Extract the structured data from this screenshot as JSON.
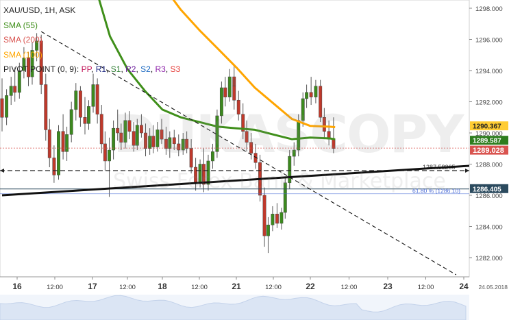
{
  "legend": {
    "instrument": "XAU/USD, 1H, ASK",
    "sma55": "SMA (55)",
    "sma200": "SMA (200)",
    "sma100": "SMA (100)",
    "pivot_prefix": "PIVOT POINT (0, 9):",
    "pivot_items": [
      "PP",
      "R1",
      "S1",
      "R2",
      "S2",
      "R3",
      "S3"
    ]
  },
  "colors": {
    "sma55": "#3f8f1a",
    "sma100": "#ffa500",
    "sma200": "#d9534f",
    "candle_up": "#3c8a1e",
    "candle_down": "#c0392b",
    "pp": "#c2185b",
    "r1": "#1a237e",
    "s1": "#2e7d32",
    "r2": "#6a1b9a",
    "s2": "#1565c0",
    "r3": "#8e24aa",
    "s3": "#e53935",
    "fib_line": "#4a6bd6",
    "support_label": "#2b4a5e"
  },
  "watermark": {
    "brand": "DUKASCOPY",
    "tagline": "Swiss Forex Bank & Marketplace"
  },
  "chart_data": {
    "type": "candlestick",
    "symbol": "XAU/USD",
    "timeframe": "1H",
    "price_type": "ASK",
    "ylim": [
      1281.0,
      1299.0
    ],
    "y_ticks": [
      1282.0,
      1284.0,
      1286.0,
      1288.0,
      1290.0,
      1292.0,
      1294.0,
      1296.0,
      1298.0
    ],
    "y_tick_labels": [
      "1282.000",
      "1284.000",
      "1286.000",
      "1288.000",
      "1290.000",
      "1292.000",
      "1294.000",
      "1296.000",
      "1298.000"
    ],
    "x_ticks": [
      {
        "label": "16",
        "day": 16,
        "hour": 0,
        "bold": true
      },
      {
        "label": "12:00",
        "day": 16,
        "hour": 12,
        "bold": false
      },
      {
        "label": "17",
        "day": 17,
        "hour": 0,
        "bold": true
      },
      {
        "label": "12:00",
        "day": 17,
        "hour": 12,
        "bold": false
      },
      {
        "label": "18",
        "day": 18,
        "hour": 0,
        "bold": true
      },
      {
        "label": "12:00",
        "day": 18,
        "hour": 12,
        "bold": false
      },
      {
        "label": "21",
        "day": 21,
        "hour": 0,
        "bold": true
      },
      {
        "label": "12:00",
        "day": 21,
        "hour": 12,
        "bold": false
      },
      {
        "label": "22",
        "day": 22,
        "hour": 0,
        "bold": true
      },
      {
        "label": "12:00",
        "day": 22,
        "hour": 12,
        "bold": false
      },
      {
        "label": "23",
        "day": 23,
        "hour": 0,
        "bold": true
      },
      {
        "label": "12:00",
        "day": 23,
        "hour": 12,
        "bold": false
      },
      {
        "label": "24",
        "day": 24,
        "hour": 0,
        "bold": true
      }
    ],
    "date_corner_label": "24.05.2018",
    "price_labels": [
      {
        "value": 1290.367,
        "text": "1290.367",
        "series": "sma100"
      },
      {
        "value": 1289.587,
        "text": "1289.587",
        "series": "sma55"
      },
      {
        "value": 1289.028,
        "text": "1289.028",
        "series": "last_price"
      },
      {
        "value": 1286.405,
        "text": "1286.405",
        "series": "support"
      }
    ],
    "annotations": [
      {
        "type": "horizontal",
        "style": "dashed",
        "value": 1287.58265,
        "text": "1287.58265"
      },
      {
        "type": "horizontal",
        "style": "solid",
        "value": 1286.405
      },
      {
        "type": "fibonacci",
        "value": 1286.1,
        "text": "61.80 % (1286.10)"
      },
      {
        "type": "trendline",
        "style": "solid",
        "from": {
          "day": 15.8,
          "value": 1286.0
        },
        "to": {
          "day": 24.1,
          "value": 1287.9
        }
      },
      {
        "type": "trendline",
        "style": "dashed",
        "from": {
          "day": 16.32,
          "value": 1296.5
        },
        "to": {
          "day": 23.9,
          "value": 1280.9
        }
      }
    ],
    "series": [
      {
        "name": "SMA (55)",
        "key": "sma55",
        "points": [
          {
            "day": 17.0,
            "value": 1300.0
          },
          {
            "day": 17.25,
            "value": 1296.2
          },
          {
            "day": 17.5,
            "value": 1294.1
          },
          {
            "day": 17.75,
            "value": 1292.7
          },
          {
            "day": 18.0,
            "value": 1291.5
          },
          {
            "day": 18.25,
            "value": 1291.0
          },
          {
            "day": 18.5,
            "value": 1290.7
          },
          {
            "day": 18.75,
            "value": 1290.4
          },
          {
            "day": 21.0,
            "value": 1290.3
          },
          {
            "day": 21.25,
            "value": 1290.2
          },
          {
            "day": 21.5,
            "value": 1289.9
          },
          {
            "day": 21.75,
            "value": 1289.6
          },
          {
            "day": 22.0,
            "value": 1289.7
          },
          {
            "day": 22.25,
            "value": 1289.65
          },
          {
            "day": 22.32,
            "value": 1289.59
          }
        ]
      },
      {
        "name": "SMA (100)",
        "key": "sma100",
        "points": [
          {
            "day": 18.0,
            "value": 1299.5
          },
          {
            "day": 18.25,
            "value": 1297.9
          },
          {
            "day": 18.5,
            "value": 1296.6
          },
          {
            "day": 18.75,
            "value": 1295.4
          },
          {
            "day": 21.0,
            "value": 1294.2
          },
          {
            "day": 21.25,
            "value": 1292.9
          },
          {
            "day": 21.5,
            "value": 1291.9
          },
          {
            "day": 21.75,
            "value": 1290.9
          },
          {
            "day": 22.0,
            "value": 1290.45
          },
          {
            "day": 22.25,
            "value": 1290.4
          },
          {
            "day": 22.32,
            "value": 1290.37
          }
        ]
      },
      {
        "name": "Last price",
        "key": "last_price",
        "value": 1289.028
      }
    ],
    "candles": [
      {
        "day": 15.8,
        "open": 1292.2,
        "high": 1293.5,
        "low": 1290.1,
        "close": 1291.0
      },
      {
        "day": 15.86,
        "open": 1291.0,
        "high": 1292.8,
        "low": 1290.5,
        "close": 1292.4
      },
      {
        "day": 15.92,
        "open": 1292.4,
        "high": 1293.6,
        "low": 1291.8,
        "close": 1293.0
      },
      {
        "day": 15.97,
        "open": 1293.0,
        "high": 1294.2,
        "low": 1292.0,
        "close": 1292.6
      },
      {
        "day": 16.03,
        "open": 1292.6,
        "high": 1294.5,
        "low": 1292.2,
        "close": 1294.0
      },
      {
        "day": 16.09,
        "open": 1294.0,
        "high": 1295.5,
        "low": 1293.5,
        "close": 1294.8
      },
      {
        "day": 16.15,
        "open": 1294.8,
        "high": 1295.2,
        "low": 1293.0,
        "close": 1293.6
      },
      {
        "day": 16.2,
        "open": 1293.6,
        "high": 1295.8,
        "low": 1293.1,
        "close": 1295.3
      },
      {
        "day": 16.26,
        "open": 1295.3,
        "high": 1296.4,
        "low": 1294.6,
        "close": 1295.9
      },
      {
        "day": 16.32,
        "open": 1295.9,
        "high": 1296.3,
        "low": 1292.5,
        "close": 1293.1
      },
      {
        "day": 16.38,
        "open": 1293.1,
        "high": 1293.8,
        "low": 1289.5,
        "close": 1290.2
      },
      {
        "day": 16.43,
        "open": 1290.2,
        "high": 1290.9,
        "low": 1287.8,
        "close": 1288.4
      },
      {
        "day": 16.49,
        "open": 1288.4,
        "high": 1289.2,
        "low": 1286.8,
        "close": 1287.3
      },
      {
        "day": 16.55,
        "open": 1287.3,
        "high": 1290.5,
        "low": 1287.0,
        "close": 1290.1
      },
      {
        "day": 16.61,
        "open": 1290.1,
        "high": 1291.2,
        "low": 1288.3,
        "close": 1288.8
      },
      {
        "day": 16.66,
        "open": 1288.8,
        "high": 1290.4,
        "low": 1288.2,
        "close": 1289.9
      },
      {
        "day": 16.72,
        "open": 1289.9,
        "high": 1292.0,
        "low": 1289.4,
        "close": 1291.5
      },
      {
        "day": 16.78,
        "open": 1291.5,
        "high": 1293.2,
        "low": 1290.8,
        "close": 1292.7
      },
      {
        "day": 16.84,
        "open": 1292.7,
        "high": 1293.0,
        "low": 1290.4,
        "close": 1291.0
      },
      {
        "day": 16.9,
        "open": 1291.0,
        "high": 1292.3,
        "low": 1289.9,
        "close": 1290.6
      },
      {
        "day": 16.95,
        "open": 1290.6,
        "high": 1292.1,
        "low": 1290.2,
        "close": 1291.7
      },
      {
        "day": 17.01,
        "open": 1291.7,
        "high": 1293.8,
        "low": 1291.3,
        "close": 1293.1
      },
      {
        "day": 17.07,
        "open": 1293.1,
        "high": 1293.5,
        "low": 1290.6,
        "close": 1291.2
      },
      {
        "day": 17.13,
        "open": 1291.2,
        "high": 1291.8,
        "low": 1288.7,
        "close": 1289.3
      },
      {
        "day": 17.18,
        "open": 1289.3,
        "high": 1290.1,
        "low": 1287.6,
        "close": 1288.2
      },
      {
        "day": 17.24,
        "open": 1288.2,
        "high": 1289.7,
        "low": 1285.9,
        "close": 1288.9
      },
      {
        "day": 17.3,
        "open": 1288.9,
        "high": 1290.8,
        "low": 1288.3,
        "close": 1290.3
      },
      {
        "day": 17.36,
        "open": 1290.3,
        "high": 1291.5,
        "low": 1289.5,
        "close": 1290.0
      },
      {
        "day": 17.41,
        "open": 1290.0,
        "high": 1290.6,
        "low": 1288.9,
        "close": 1289.4
      },
      {
        "day": 17.47,
        "open": 1289.4,
        "high": 1291.3,
        "low": 1289.0,
        "close": 1290.8
      },
      {
        "day": 17.53,
        "open": 1290.8,
        "high": 1291.4,
        "low": 1289.6,
        "close": 1290.1
      },
      {
        "day": 17.59,
        "open": 1290.1,
        "high": 1290.7,
        "low": 1288.8,
        "close": 1289.2
      },
      {
        "day": 17.64,
        "open": 1289.2,
        "high": 1290.9,
        "low": 1288.9,
        "close": 1290.5
      },
      {
        "day": 17.7,
        "open": 1290.5,
        "high": 1291.2,
        "low": 1289.7,
        "close": 1290.0
      },
      {
        "day": 17.76,
        "open": 1290.0,
        "high": 1290.6,
        "low": 1288.5,
        "close": 1289.0
      },
      {
        "day": 17.82,
        "open": 1289.0,
        "high": 1290.3,
        "low": 1288.6,
        "close": 1289.8
      },
      {
        "day": 17.87,
        "open": 1289.8,
        "high": 1290.5,
        "low": 1288.7,
        "close": 1289.1
      },
      {
        "day": 17.93,
        "open": 1289.1,
        "high": 1290.7,
        "low": 1288.8,
        "close": 1290.2
      },
      {
        "day": 17.99,
        "open": 1290.2,
        "high": 1290.9,
        "low": 1289.3,
        "close": 1289.6
      },
      {
        "day": 18.05,
        "open": 1289.6,
        "high": 1290.4,
        "low": 1288.6,
        "close": 1289.0
      },
      {
        "day": 18.1,
        "open": 1289.0,
        "high": 1290.1,
        "low": 1288.4,
        "close": 1289.7
      },
      {
        "day": 18.16,
        "open": 1289.7,
        "high": 1290.2,
        "low": 1288.9,
        "close": 1289.3
      },
      {
        "day": 18.22,
        "open": 1289.3,
        "high": 1289.9,
        "low": 1288.5,
        "close": 1288.9
      },
      {
        "day": 18.28,
        "open": 1288.9,
        "high": 1290.0,
        "low": 1288.6,
        "close": 1289.6
      },
      {
        "day": 18.33,
        "open": 1289.6,
        "high": 1290.1,
        "low": 1288.7,
        "close": 1289.0
      },
      {
        "day": 18.39,
        "open": 1289.0,
        "high": 1289.6,
        "low": 1287.4,
        "close": 1287.8
      },
      {
        "day": 18.45,
        "open": 1287.8,
        "high": 1288.4,
        "low": 1286.3,
        "close": 1286.8
      },
      {
        "day": 18.51,
        "open": 1286.8,
        "high": 1288.3,
        "low": 1286.5,
        "close": 1288.0
      },
      {
        "day": 18.56,
        "open": 1288.0,
        "high": 1289.0,
        "low": 1286.2,
        "close": 1286.7
      },
      {
        "day": 18.62,
        "open": 1286.7,
        "high": 1288.6,
        "low": 1286.3,
        "close": 1288.2
      },
      {
        "day": 18.68,
        "open": 1288.2,
        "high": 1289.3,
        "low": 1287.7,
        "close": 1288.8
      },
      {
        "day": 18.74,
        "open": 1288.8,
        "high": 1291.5,
        "low": 1288.4,
        "close": 1291.1
      },
      {
        "day": 18.8,
        "open": 1291.1,
        "high": 1293.3,
        "low": 1290.6,
        "close": 1292.9
      },
      {
        "day": 18.85,
        "open": 1292.9,
        "high": 1293.6,
        "low": 1291.7,
        "close": 1292.3
      },
      {
        "day": 18.91,
        "open": 1292.3,
        "high": 1294.1,
        "low": 1292.0,
        "close": 1293.6
      },
      {
        "day": 18.97,
        "open": 1293.6,
        "high": 1294.4,
        "low": 1292.6,
        "close": 1293.0
      },
      {
        "day": 20.97,
        "open": 1293.0,
        "high": 1293.5,
        "low": 1291.5,
        "close": 1292.1
      },
      {
        "day": 21.03,
        "open": 1292.1,
        "high": 1292.7,
        "low": 1290.8,
        "close": 1291.2
      },
      {
        "day": 21.09,
        "open": 1291.2,
        "high": 1291.9,
        "low": 1289.6,
        "close": 1290.1
      },
      {
        "day": 21.14,
        "open": 1290.1,
        "high": 1290.8,
        "low": 1288.8,
        "close": 1289.4
      },
      {
        "day": 21.2,
        "open": 1289.4,
        "high": 1290.0,
        "low": 1288.3,
        "close": 1288.7
      },
      {
        "day": 21.26,
        "open": 1288.7,
        "high": 1289.3,
        "low": 1287.7,
        "close": 1288.1
      },
      {
        "day": 21.32,
        "open": 1288.1,
        "high": 1288.6,
        "low": 1285.6,
        "close": 1286.0
      },
      {
        "day": 21.38,
        "open": 1286.0,
        "high": 1286.5,
        "low": 1282.7,
        "close": 1283.4
      },
      {
        "day": 21.43,
        "open": 1283.4,
        "high": 1284.6,
        "low": 1282.3,
        "close": 1284.1
      },
      {
        "day": 21.49,
        "open": 1284.1,
        "high": 1285.3,
        "low": 1283.7,
        "close": 1284.8
      },
      {
        "day": 21.55,
        "open": 1284.8,
        "high": 1285.5,
        "low": 1283.9,
        "close": 1284.2
      },
      {
        "day": 21.61,
        "open": 1284.2,
        "high": 1285.2,
        "low": 1283.8,
        "close": 1284.9
      },
      {
        "day": 21.66,
        "open": 1284.9,
        "high": 1287.2,
        "low": 1284.5,
        "close": 1286.8
      },
      {
        "day": 21.72,
        "open": 1286.8,
        "high": 1288.9,
        "low": 1286.4,
        "close": 1288.5
      },
      {
        "day": 21.78,
        "open": 1288.5,
        "high": 1289.4,
        "low": 1287.9,
        "close": 1288.9
      },
      {
        "day": 21.84,
        "open": 1288.9,
        "high": 1291.2,
        "low": 1288.5,
        "close": 1290.8
      },
      {
        "day": 21.9,
        "open": 1290.8,
        "high": 1292.6,
        "low": 1290.4,
        "close": 1292.2
      },
      {
        "day": 21.95,
        "open": 1292.2,
        "high": 1293.1,
        "low": 1291.6,
        "close": 1292.6
      },
      {
        "day": 22.01,
        "open": 1292.6,
        "high": 1293.6,
        "low": 1291.8,
        "close": 1292.3
      },
      {
        "day": 22.07,
        "open": 1292.3,
        "high": 1293.4,
        "low": 1291.9,
        "close": 1293.0
      },
      {
        "day": 22.13,
        "open": 1293.0,
        "high": 1293.4,
        "low": 1290.7,
        "close": 1291.0
      },
      {
        "day": 22.18,
        "open": 1291.0,
        "high": 1291.6,
        "low": 1289.6,
        "close": 1290.1
      },
      {
        "day": 22.24,
        "open": 1290.1,
        "high": 1290.8,
        "low": 1289.2,
        "close": 1289.6
      },
      {
        "day": 22.3,
        "open": 1289.6,
        "high": 1291.0,
        "low": 1288.7,
        "close": 1289.0
      }
    ]
  }
}
